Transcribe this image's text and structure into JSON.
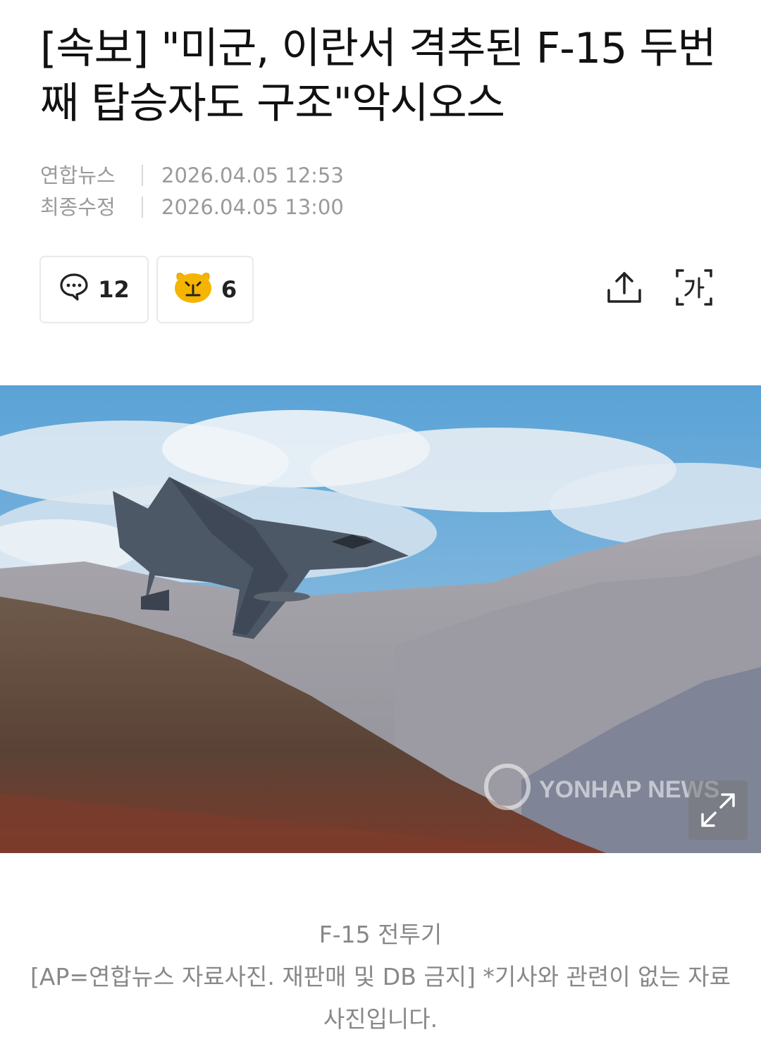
{
  "article": {
    "headline": "[속보] \"미군, 이란서 격추된 F-15 두번째 탑승자도 구조\"악시오스",
    "source_label": "연합뉴스",
    "published": "2026.04.05 12:53",
    "modified_label": "최종수정",
    "modified": "2026.04.05 13:00"
  },
  "actions": {
    "comment_count": "12",
    "reaction_count": "6",
    "icons": {
      "comment": "chat-bubble-icon",
      "reaction": "surprised-face-emoji-icon",
      "share": "share-icon",
      "font_size": "font-size-icon",
      "expand": "expand-icon"
    }
  },
  "photo": {
    "watermark": "YONHAP NEWS",
    "caption_title": "F-15 전투기",
    "caption_body": "[AP=연합뉴스 자료사진. 재판매 및 DB 금지] *기사와 관련이 없는 자료사진입니다."
  }
}
